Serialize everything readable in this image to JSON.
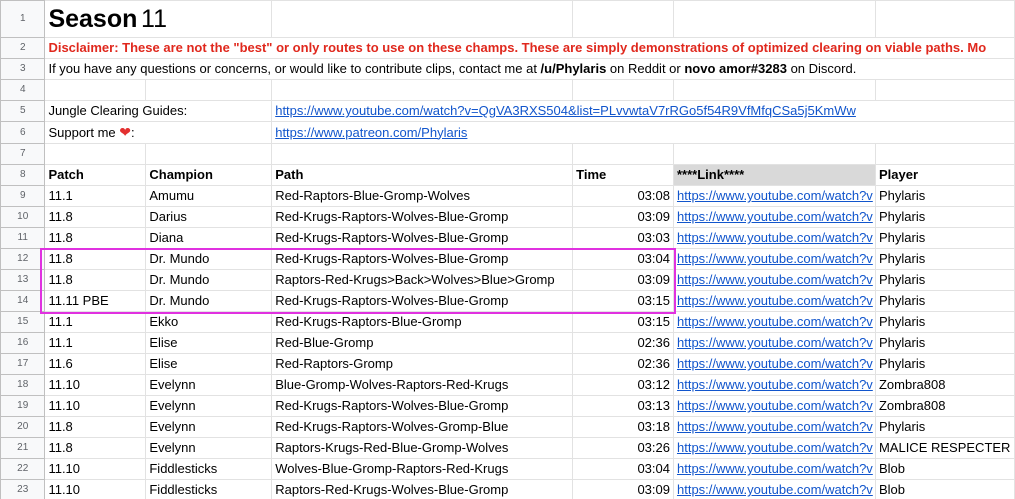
{
  "row_numbers": [
    "1",
    "2",
    "3",
    "4",
    "5",
    "6",
    "7",
    "8",
    "9",
    "10",
    "11",
    "12",
    "13",
    "14",
    "15",
    "16",
    "17",
    "18",
    "19",
    "20",
    "21",
    "22",
    "23"
  ],
  "title": {
    "season_label": "Season",
    "season_number": "11"
  },
  "disclaimer": "Disclaimer: These are not the \"best\" or only routes to use on these champs.  These are simply demonstrations of optimized clearing on viable paths.  Mo",
  "contact": {
    "prefix": "If you have any questions or concerns, or would like to contribute clips, contact me at ",
    "reddit": "/u/Phylaris",
    "middle": " on Reddit or ",
    "discord": "novo amor#3283",
    "suffix": " on Discord."
  },
  "guides": {
    "label": "Jungle Clearing Guides:",
    "url": "https://www.youtube.com/watch?v=QgVA3RXS504&list=PLvvwtaV7rRGo5f54R9VfMfqCSa5j5KmWw"
  },
  "support": {
    "label": "Support me",
    "heart": "❤",
    "colon": ":",
    "url": "https://www.patreon.com/Phylaris"
  },
  "headers": {
    "patch": "Patch",
    "champion": "Champion",
    "path": "Path",
    "time": "Time",
    "link": "****Link****",
    "player": "Player"
  },
  "rows": [
    {
      "patch": "11.1",
      "champion": "Amumu",
      "path": "Red-Raptors-Blue-Gromp-Wolves",
      "time": "03:08",
      "link": "https://www.youtube.com/watch?v",
      "player": "Phylaris"
    },
    {
      "patch": "11.8",
      "champion": "Darius",
      "path": "Red-Krugs-Raptors-Wolves-Blue-Gromp",
      "time": "03:09",
      "link": "https://www.youtube.com/watch?v",
      "player": "Phylaris"
    },
    {
      "patch": "11.8",
      "champion": "Diana",
      "path": "Red-Krugs-Raptors-Wolves-Blue-Gromp",
      "time": "03:03",
      "link": "https://www.youtube.com/watch?v",
      "player": "Phylaris"
    },
    {
      "patch": "11.8",
      "champion": "Dr. Mundo",
      "path": "Red-Krugs-Raptors-Wolves-Blue-Gromp",
      "time": "03:04",
      "link": "https://www.youtube.com/watch?v",
      "player": "Phylaris"
    },
    {
      "patch": "11.8",
      "champion": "Dr. Mundo",
      "path": "Raptors-Red-Krugs>Back>Wolves>Blue>Gromp",
      "time": "03:09",
      "link": "https://www.youtube.com/watch?v",
      "player": "Phylaris"
    },
    {
      "patch": "11.11 PBE",
      "champion": "Dr. Mundo",
      "path": "Red-Krugs-Raptors-Wolves-Blue-Gromp",
      "time": "03:15",
      "link": "https://www.youtube.com/watch?v",
      "player": "Phylaris"
    },
    {
      "patch": "11.1",
      "champion": "Ekko",
      "path": "Red-Krugs-Raptors-Blue-Gromp",
      "time": "03:15",
      "link": "https://www.youtube.com/watch?v",
      "player": "Phylaris"
    },
    {
      "patch": "11.1",
      "champion": "Elise",
      "path": "Red-Blue-Gromp",
      "time": "02:36",
      "link": "https://www.youtube.com/watch?v",
      "player": "Phylaris"
    },
    {
      "patch": "11.6",
      "champion": "Elise",
      "path": "Red-Raptors-Gromp",
      "time": "02:36",
      "link": "https://www.youtube.com/watch?v",
      "player": "Phylaris"
    },
    {
      "patch": "11.10",
      "champion": "Evelynn",
      "path": "Blue-Gromp-Wolves-Raptors-Red-Krugs",
      "time": "03:12",
      "link": "https://www.youtube.com/watch?v",
      "player": "Zombra808"
    },
    {
      "patch": "11.10",
      "champion": "Evelynn",
      "path": "Red-Krugs-Raptors-Wolves-Blue-Gromp",
      "time": "03:13",
      "link": "https://www.youtube.com/watch?v",
      "player": "Zombra808"
    },
    {
      "patch": "11.8",
      "champion": "Evelynn",
      "path": "Red-Krugs-Raptors-Wolves-Gromp-Blue",
      "time": "03:18",
      "link": "https://www.youtube.com/watch?v",
      "player": "Phylaris"
    },
    {
      "patch": "11.8",
      "champion": "Evelynn",
      "path": "Raptors-Krugs-Red-Blue-Gromp-Wolves",
      "time": "03:26",
      "link": "https://www.youtube.com/watch?v",
      "player": "MALICE RESPECTER"
    },
    {
      "patch": "11.10",
      "champion": "Fiddlesticks",
      "path": "Wolves-Blue-Gromp-Raptors-Red-Krugs",
      "time": "03:04",
      "link": "https://www.youtube.com/watch?v",
      "player": "Blob"
    },
    {
      "patch": "11.10",
      "champion": "Fiddlesticks",
      "path": "Raptors-Red-Krugs-Wolves-Blue-Gromp",
      "time": "03:09",
      "link": "https://www.youtube.com/watch?v",
      "player": "Blob"
    }
  ]
}
